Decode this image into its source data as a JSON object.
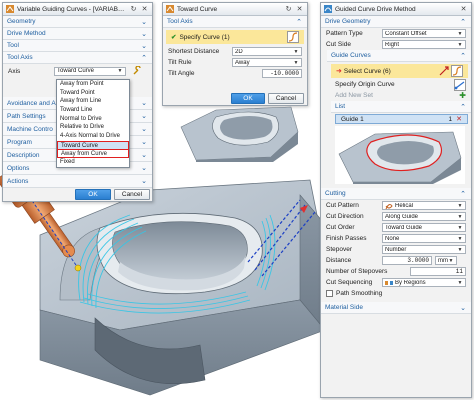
{
  "dlg1": {
    "title": "Variable Guiding Curves - [VARIABLE_...",
    "groups": [
      "Geometry",
      "Drive Method",
      "Tool"
    ],
    "tool_axis_group": "Tool Axis",
    "axis_label": "Axis",
    "axis_value": "Toward Curve",
    "dropdown_options": [
      "Away from Point",
      "Toward Point",
      "Away from Line",
      "Toward Line",
      "Normal to Drive",
      "Relative to Drive",
      "4-Axis Normal to Drive",
      "Toward Curve",
      "Away from Curve",
      "Fixed"
    ],
    "hidden_groups": [
      "Avoidance and A",
      "Path Settings",
      "Machine Contro",
      "Program",
      "Description"
    ],
    "options_group": "Options",
    "actions_group": "Actions",
    "ok": "OK",
    "cancel": "Cancel"
  },
  "dlg2": {
    "title": "Toward Curve",
    "group": "Tool Axis",
    "specify_curve": "Specify Curve (1)",
    "rows": [
      {
        "label": "Shortest Distance",
        "value": "2D"
      },
      {
        "label": "Tilt Rule",
        "value": "Away"
      }
    ],
    "tilt_angle_label": "Tilt Angle",
    "tilt_angle_value": "-10.0000",
    "ok": "OK",
    "cancel": "Cancel"
  },
  "dlg3": {
    "title": "Guided Curve Drive Method",
    "drive_geometry_group": "Drive Geometry",
    "pattern_type_label": "Pattern Type",
    "pattern_type_value": "Constant Offset",
    "cut_side_label": "Cut Side",
    "cut_side_value": "Right",
    "guide_curves_group": "Guide Curves",
    "select_curve": "Select Curve (6)",
    "specify_origin": "Specify Origin Curve",
    "add_new_set": "Add New Set",
    "list_group": "List",
    "list_item": "Guide 1",
    "list_item_count": "1",
    "cutting_group": "Cutting",
    "cutting_rows": [
      {
        "label": "Cut Pattern",
        "value": "Helical"
      },
      {
        "label": "Cut Direction",
        "value": "Along Guide"
      },
      {
        "label": "Cut Order",
        "value": "Toward Guide"
      },
      {
        "label": "Finish Passes",
        "value": "None"
      },
      {
        "label": "Stepover",
        "value": "Number"
      }
    ],
    "distance_label": "Distance",
    "distance_value": "3.0000",
    "distance_unit": "mm",
    "num_stepovers_label": "Number of Stepovers",
    "num_stepovers_value": "11",
    "cut_sequencing_label": "Cut Sequencing",
    "cut_sequencing_value": "By Regions",
    "path_smoothing": "Path Smoothing",
    "material_side_group": "Material Side"
  },
  "colors": {
    "accent": "#1f5fa0",
    "highlight": "#fbe79a",
    "selection_red": "#e02020",
    "tool_orange": "#d9804a",
    "part_gray": "#9aa7b4",
    "path_cyan": "#35c6e6"
  }
}
